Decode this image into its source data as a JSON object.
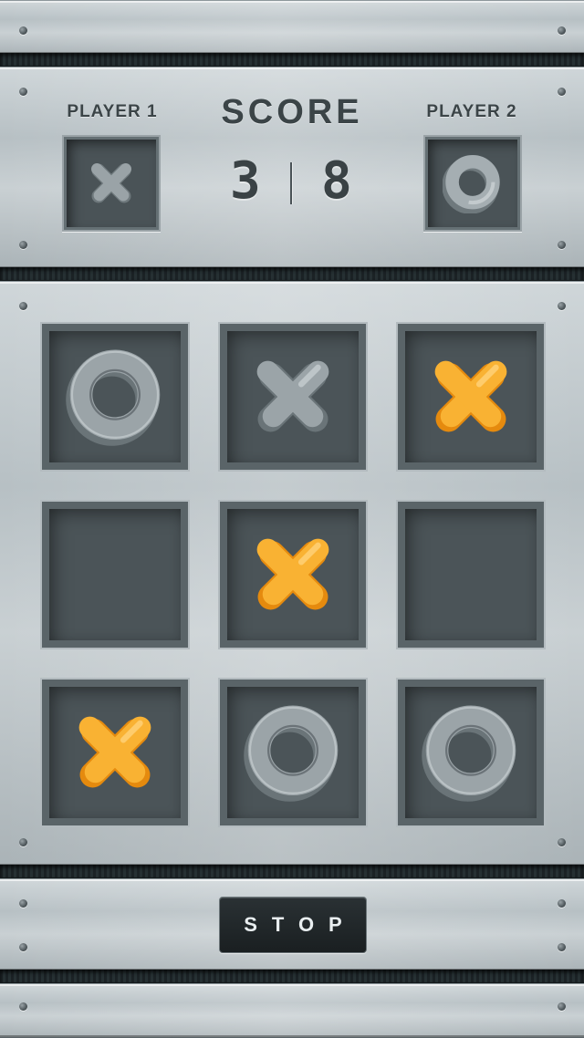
{
  "scoreboard": {
    "title": "SCORE",
    "player1": {
      "label": "PLAYER 1",
      "mark": "x",
      "score": "3"
    },
    "player2": {
      "label": "PLAYER 2",
      "mark": "o",
      "score": "8"
    }
  },
  "board": {
    "cells": [
      {
        "mark": "o",
        "color": "gray"
      },
      {
        "mark": "x",
        "color": "gray"
      },
      {
        "mark": "x",
        "color": "orange"
      },
      {
        "mark": "",
        "color": ""
      },
      {
        "mark": "x",
        "color": "orange"
      },
      {
        "mark": "",
        "color": ""
      },
      {
        "mark": "x",
        "color": "orange"
      },
      {
        "mark": "o",
        "color": "gray"
      },
      {
        "mark": "o",
        "color": "gray"
      }
    ]
  },
  "controls": {
    "stop_label": "STOP"
  },
  "colors": {
    "orange": "#f5a623",
    "gray": "#8e979b",
    "metal": "#c4cccf",
    "dark": "#1a1f21"
  },
  "icons": {
    "x_mark": "x-icon",
    "o_mark": "o-icon"
  }
}
